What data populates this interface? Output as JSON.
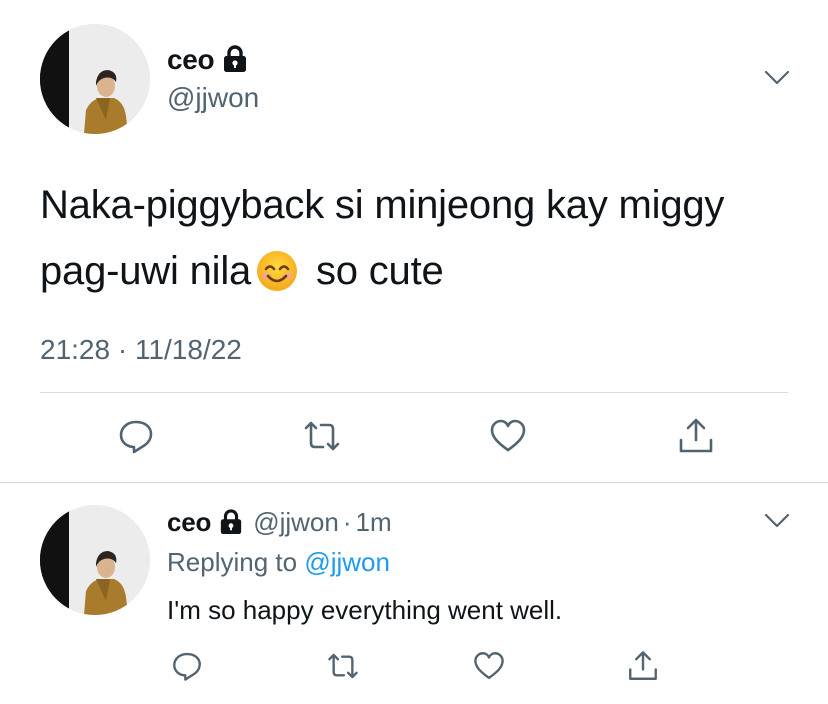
{
  "main_tweet": {
    "name": "ceo",
    "handle": "@jjwon",
    "text_before_emoji": "Naka-piggyback si minjeong kay miggy pag-uwi nila",
    "text_after_emoji": " so cute",
    "emoji": "smiling-face-with-smiling-eyes",
    "timestamp": "21:28 · 11/18/22",
    "actions": [
      "reply",
      "retweet",
      "like",
      "share"
    ]
  },
  "reply": {
    "name": "ceo",
    "handle": "@jjwon",
    "separator": "·",
    "time": "1m",
    "replying_prefix": "Replying to",
    "replying_to": "@jjwon",
    "text": "I'm so happy everything went well.",
    "actions": [
      "reply",
      "retweet",
      "like",
      "share"
    ]
  },
  "colors": {
    "text": "#0f1419",
    "secondary": "#536471",
    "link": "#1d9bf0",
    "divider": "#d8dde1"
  }
}
